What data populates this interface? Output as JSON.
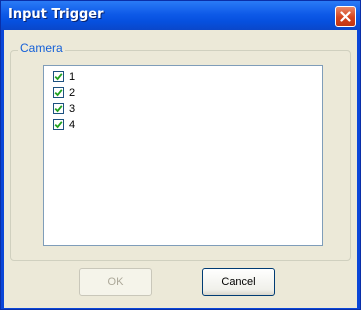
{
  "window": {
    "title": "Input Trigger"
  },
  "group": {
    "label": "Camera"
  },
  "cameras": [
    {
      "label": "1",
      "checked": true
    },
    {
      "label": "2",
      "checked": true
    },
    {
      "label": "3",
      "checked": true
    },
    {
      "label": "4",
      "checked": true
    }
  ],
  "buttons": {
    "ok_label": "OK",
    "ok_enabled": false,
    "cancel_label": "Cancel"
  },
  "colors": {
    "check": "#21a121",
    "group_label": "#1560d8",
    "titlebar": "#0e5ae8",
    "close": "#d4431d"
  }
}
